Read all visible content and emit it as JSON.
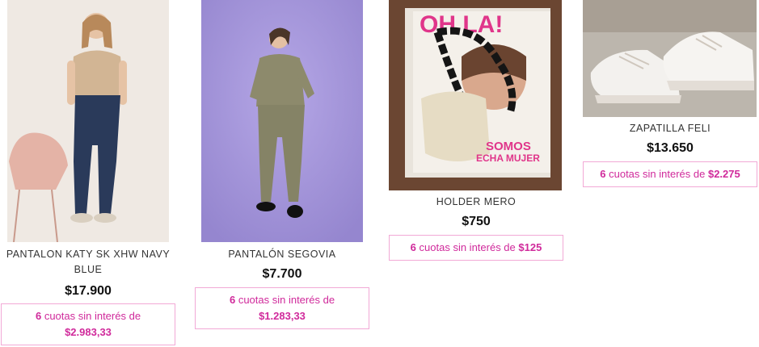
{
  "products": [
    {
      "name_line1": "PANTALON KATY SK XHW NAVY",
      "name_line2": "BLUE",
      "price": "$17.900",
      "installments_count": "6",
      "installments_text": "cuotas sin interés de",
      "installments_amount": "$2.983,33",
      "image_icon": "product-photo-jeans"
    },
    {
      "name": "PANTALÓN SEGOVIA",
      "price": "$7.700",
      "installments_count": "6",
      "installments_text": "cuotas sin interés de",
      "installments_amount": "$1.283,33",
      "image_icon": "product-photo-jogger"
    },
    {
      "name": "HOLDER MERO",
      "price": "$750",
      "installments_count": "6",
      "installments_text": "cuotas sin interés de",
      "installments_amount": "$125",
      "image_icon": "product-photo-magazine"
    },
    {
      "name": "ZAPATILLA FELI",
      "price": "$13.650",
      "installments_count": "6",
      "installments_text": "cuotas sin interés de",
      "installments_amount": "$2.275",
      "image_icon": "product-photo-sneakers"
    }
  ],
  "magazine_cover": {
    "logo": "OH LA!",
    "headline": "SOMOS",
    "headline2": "ECHA MUJER"
  },
  "colors": {
    "accent": "#d02a9b",
    "border": "#f2a9d6"
  }
}
